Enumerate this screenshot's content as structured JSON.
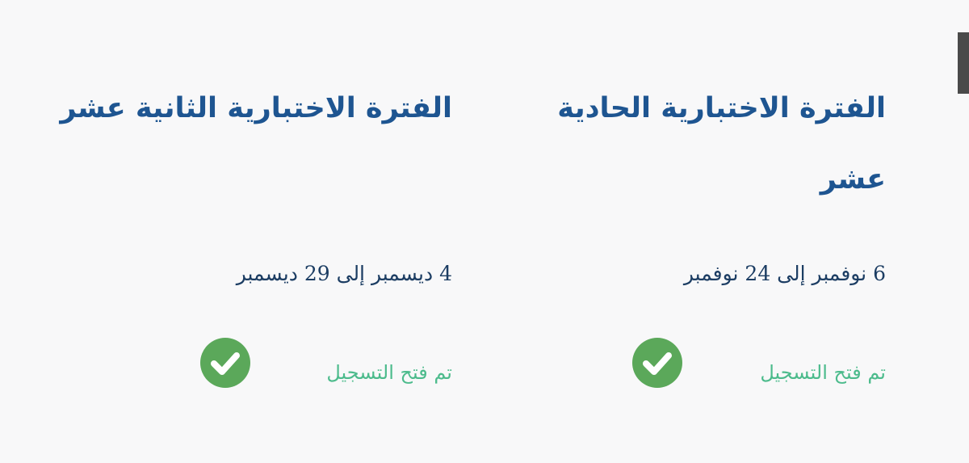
{
  "periods": [
    {
      "title": "الفترة الاختبارية الحادية عشر",
      "dates": "6 نوفمبر إلى 24 نوفمبر",
      "status": "تم فتح التسجيل",
      "icon": "check-circle-icon"
    },
    {
      "title": "الفترة الاختبارية الثانية عشر",
      "dates": "4 ديسمبر إلى 29 ديسمبر",
      "status": "تم فتح التسجيل",
      "icon": "check-circle-icon"
    }
  ],
  "colors": {
    "title": "#1e5591",
    "date": "#1c3d63",
    "status": "#4cbb8c",
    "check": "#5ba85a",
    "background": "#f8f8f9"
  }
}
